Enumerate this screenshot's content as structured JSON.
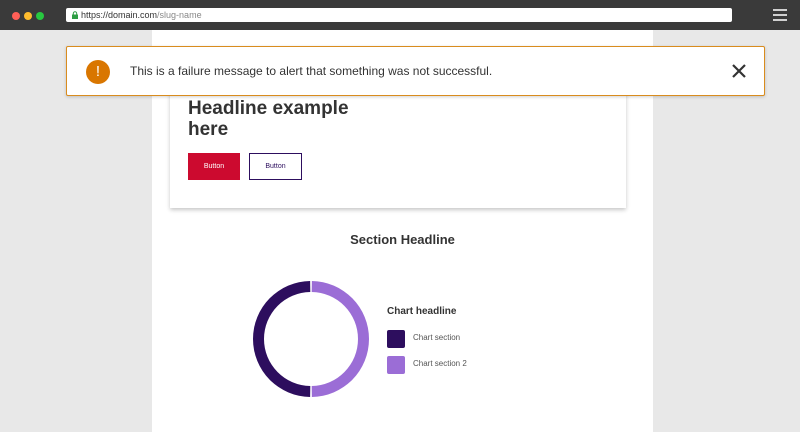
{
  "browser": {
    "url_host": "https://domain.com",
    "url_path": "/slug-name"
  },
  "alert": {
    "icon_glyph": "!",
    "message": "This is a failure message to alert that something was not successful.",
    "icon": "exclamation-icon",
    "close_icon": "close-icon",
    "accent_color": "#d97600"
  },
  "card": {
    "headline": "Headline example here",
    "primary_button_label": "Button",
    "secondary_button_label": "Button",
    "primary_color": "#cc0a2f",
    "secondary_color": "#2d0e5e"
  },
  "section": {
    "headline": "Section Headline"
  },
  "chart": {
    "headline": "Chart headline",
    "legend": [
      {
        "label": "Chart section",
        "color": "#2d0e5e"
      },
      {
        "label": "Chart section 2",
        "color": "#9b6dd6"
      }
    ]
  },
  "chart_data": {
    "type": "pie",
    "title": "Chart headline",
    "categories": [
      "Chart section",
      "Chart section 2"
    ],
    "values": [
      50,
      50
    ],
    "colors": [
      "#2d0e5e",
      "#9b6dd6"
    ],
    "donut": true,
    "legend_position": "right"
  }
}
